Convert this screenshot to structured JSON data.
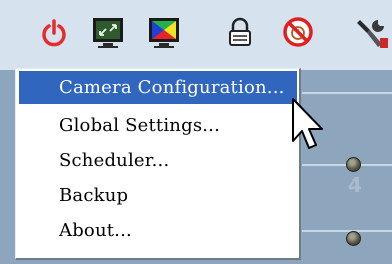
{
  "toolbar": {
    "buttons": [
      {
        "name": "power",
        "icon": "power-icon",
        "color": "#e62b2b"
      },
      {
        "name": "monitor-layout",
        "icon": "monitor-expand-icon"
      },
      {
        "name": "monitor-color",
        "icon": "monitor-color-icon"
      },
      {
        "name": "lock",
        "icon": "padlock-icon"
      },
      {
        "name": "no-clock",
        "icon": "prohibited-clock-icon",
        "color": "#e02020"
      },
      {
        "name": "tools",
        "icon": "tools-icon"
      }
    ]
  },
  "background": {
    "digit": "4"
  },
  "menu": {
    "items": [
      {
        "label": "Camera Configuration...",
        "selected": true
      },
      {
        "label": "Global Settings...",
        "selected": false
      },
      {
        "label": "Scheduler...",
        "selected": false
      },
      {
        "label": "Backup",
        "selected": false
      },
      {
        "label": "About...",
        "selected": false
      }
    ],
    "highlight_color": "#3066bd"
  }
}
